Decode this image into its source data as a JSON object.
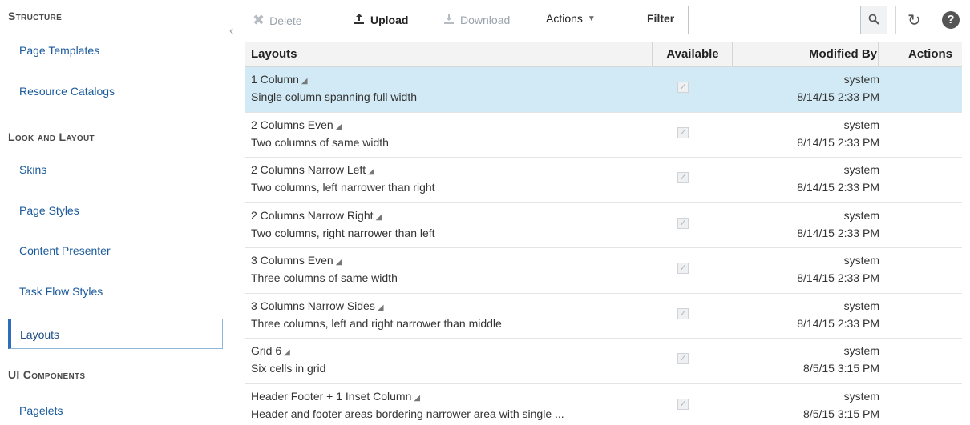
{
  "sidebar": {
    "sections": [
      {
        "title": "Structure",
        "items": [
          "Page Templates",
          "Resource Catalogs"
        ]
      },
      {
        "title": "Look and Layout",
        "items": [
          "Skins",
          "Page Styles",
          "Content Presenter",
          "Task Flow Styles",
          "Layouts"
        ]
      },
      {
        "title": "UI Components",
        "items": [
          "Pagelets"
        ]
      }
    ],
    "selected": "Layouts"
  },
  "toolbar": {
    "delete_label": "Delete",
    "upload_label": "Upload",
    "download_label": "Download",
    "actions_label": "Actions",
    "filter_label": "Filter",
    "filter_value": ""
  },
  "table": {
    "headers": {
      "layouts": "Layouts",
      "available": "Available",
      "modified_by": "Modified By",
      "actions": "Actions"
    },
    "rows": [
      {
        "name": "1 Column",
        "desc": "Single column spanning full width",
        "user": "system",
        "date": "8/14/15 2:33 PM",
        "selected": true
      },
      {
        "name": "2 Columns Even",
        "desc": "Two columns of same width",
        "user": "system",
        "date": "8/14/15 2:33 PM"
      },
      {
        "name": "2 Columns Narrow Left",
        "desc": "Two columns, left narrower than right",
        "user": "system",
        "date": "8/14/15 2:33 PM"
      },
      {
        "name": "2 Columns Narrow Right",
        "desc": "Two columns, right narrower than left",
        "user": "system",
        "date": "8/14/15 2:33 PM"
      },
      {
        "name": "3 Columns Even",
        "desc": "Three columns of same width",
        "user": "system",
        "date": "8/14/15 2:33 PM"
      },
      {
        "name": "3 Columns Narrow Sides",
        "desc": "Three columns, left and right narrower than middle",
        "user": "system",
        "date": "8/14/15 2:33 PM"
      },
      {
        "name": "Grid 6",
        "desc": "Six cells in grid",
        "user": "system",
        "date": "8/5/15 3:15 PM"
      },
      {
        "name": "Header Footer + 1 Inset Column",
        "desc": "Header and footer areas bordering narrower area with single ...",
        "user": "system",
        "date": "8/5/15 3:15 PM"
      }
    ]
  },
  "colors": {
    "link": "#1a5a9c",
    "selected_row": "#d1eaf5",
    "selected_accent": "#2d6dbc"
  }
}
